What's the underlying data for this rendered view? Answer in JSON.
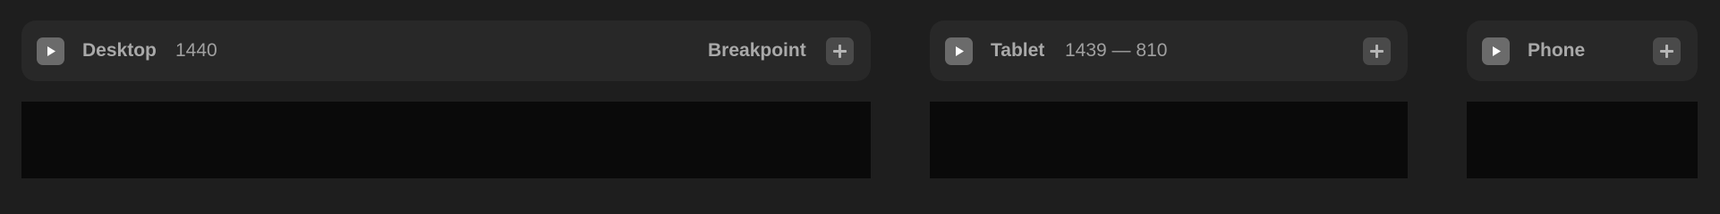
{
  "frames": [
    {
      "name": "Desktop",
      "size": "1440",
      "breakpoint_label": "Breakpoint",
      "preview_icon": "play-icon",
      "add_icon": "plus-icon"
    },
    {
      "name": "Tablet",
      "size": "1439 — 810",
      "preview_icon": "play-icon",
      "add_icon": "plus-icon"
    },
    {
      "name": "Phone",
      "preview_icon": "play-icon",
      "add_icon": "plus-icon"
    }
  ],
  "colors": {
    "canvas_background": "#1e1e1e",
    "header_background": "#282828",
    "viewport_background": "#0a0a0a",
    "preview_button": "#6b6b6b",
    "add_button": "#4a4a4a",
    "text": "#a9a9a9"
  }
}
